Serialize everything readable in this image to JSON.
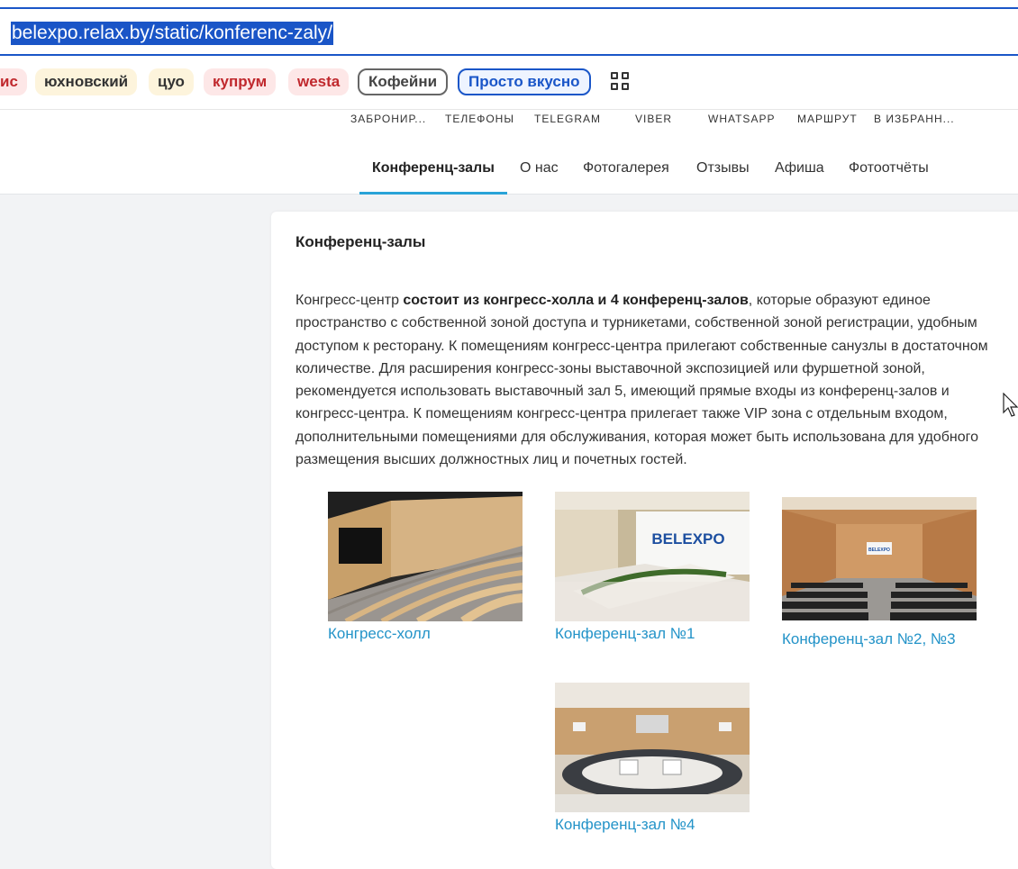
{
  "browser": {
    "url": "belexpo.relax.by/static/konferenc-zaly/"
  },
  "bookmarks": [
    {
      "label": "ис",
      "style": "red"
    },
    {
      "label": "юхновский",
      "style": "yellow"
    },
    {
      "label": "цуо",
      "style": "yellow"
    },
    {
      "label": "купрум",
      "style": "red"
    },
    {
      "label": "westa",
      "style": "red"
    },
    {
      "label": "Кофейни",
      "style": "outline-gray"
    },
    {
      "label": "Просто вкусно",
      "style": "outline-blue"
    }
  ],
  "apps_icon": "apps-grid-icon",
  "site": {
    "utility_links": [
      "ЗАБРОНИР...",
      "ТЕЛЕФОНЫ",
      "TELEGRAM",
      "VIBER",
      "WHATSAPP",
      "МАРШРУТ",
      "В ИЗБРАНН..."
    ],
    "nav": [
      "Конференц-залы",
      "О нас",
      "Фотогалерея",
      "Отзывы",
      "Афиша",
      "Фотоотчёты"
    ],
    "active_nav": "Конференц-залы"
  },
  "content": {
    "title": "Конференц-залы",
    "intro_prefix": "Конгресс-центр ",
    "intro_bold": "состоит из конгресс-холла и 4 конференц-залов",
    "intro_rest": ", которые образуют единое пространство с собственной зоной доступа и турникетами, собственной зоной регистрации, удобным доступом к ресторану. К помещениям конгресс-центра прилегают собственные санузлы в достаточном количестве. Для расширения конгресс-зоны выставочной экспозицией или фуршетной зоной, рекомендуется использовать выставочный зал 5, имеющий прямые входы из конференц-залов и конгресс-центра. К помещениям конгресс-центра прилегает также VIP зона с отдельным входом, дополнительными помещениями для обслуживания, которая может быть использована для удобного размещения высших должностных лиц и почетных гостей.",
    "halls": [
      {
        "caption": "Конгресс-холл"
      },
      {
        "caption": "Конференц-зал №1",
        "screen_text": "BELEXPO"
      },
      {
        "caption": "Конференц-зал №2, №3",
        "screen_text": "BELEXPO"
      },
      {
        "caption": "Конференц-зал №4"
      }
    ]
  },
  "colors": {
    "accent": "#1a56c8",
    "link": "#2393c8",
    "nav_underline": "#29a3d8"
  }
}
